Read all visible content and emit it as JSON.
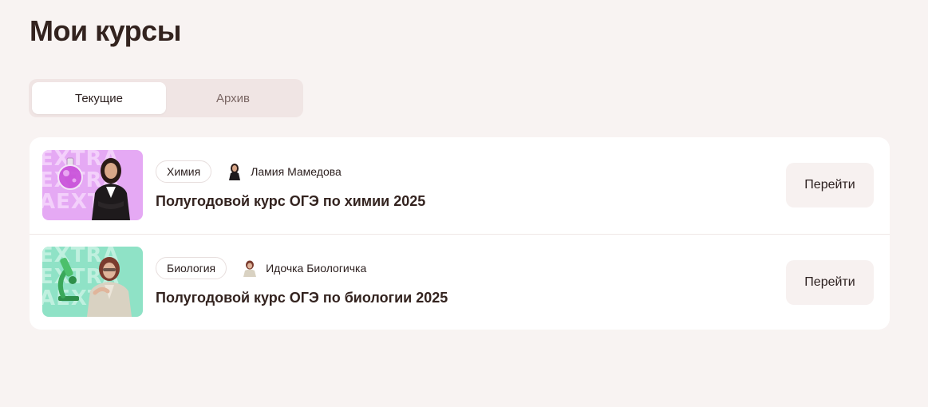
{
  "page": {
    "title": "Мои курсы"
  },
  "tabs": [
    {
      "label": "Текущие",
      "active": true
    },
    {
      "label": "Архив",
      "active": false
    }
  ],
  "courses": [
    {
      "subject": "Химия",
      "teacher": "Ламия Мамедова",
      "title": "Полугодовой курс ОГЭ по химии 2025",
      "button": "Перейти",
      "thumb_bg": "#e5a9f4",
      "thumb_text_color": "#f3d0fb",
      "thumb_watermark": "EXTRA\nEXTRA\nAEXTR",
      "icon": "flask-icon"
    },
    {
      "subject": "Биология",
      "teacher": "Идочка Биологичка",
      "title": "Полугодовой курс ОГЭ по биологии 2025",
      "button": "Перейти",
      "thumb_bg": "#8fe2c6",
      "thumb_text_color": "#c0f0df",
      "thumb_watermark": "EXTRA\nEXTRA\nAEXTR",
      "icon": "microscope-icon"
    }
  ]
}
